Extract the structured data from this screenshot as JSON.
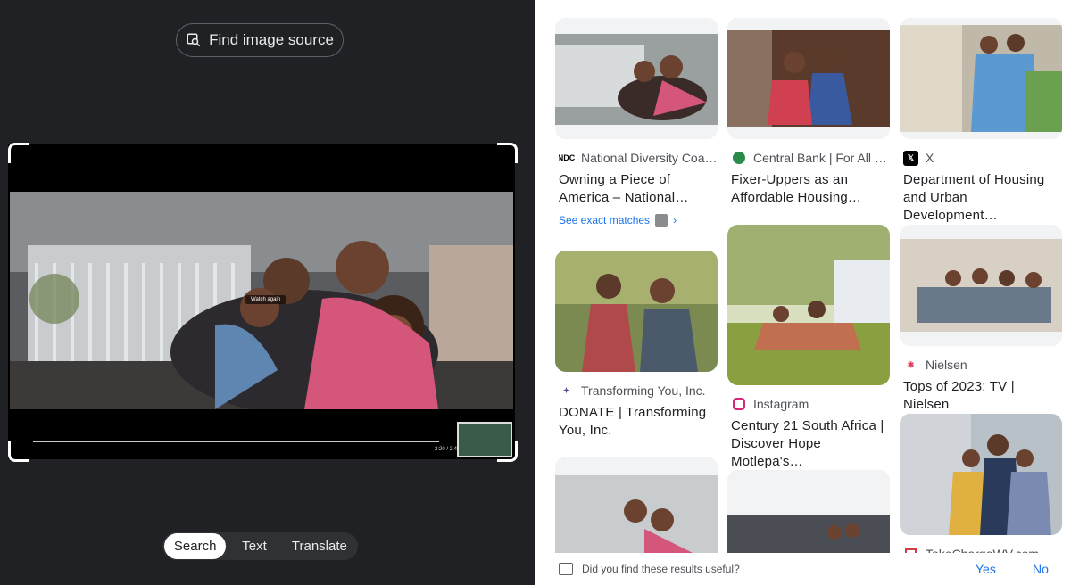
{
  "lens": {
    "find_source_label": "Find image source",
    "overlay": {
      "watch_again": "Watch again",
      "time": "2:20 / 2:4"
    },
    "modes": [
      {
        "label": "Search",
        "active": true
      },
      {
        "label": "Text",
        "active": false
      },
      {
        "label": "Translate",
        "active": false
      }
    ]
  },
  "results": [
    {
      "source": "National Diversity Coa…",
      "favicon_text": "NDC",
      "title_lines": [
        "Owning a Piece of",
        "America – National…"
      ],
      "exact_label": "See exact matches"
    },
    {
      "source": "Transforming You, Inc.",
      "title_lines": [
        "DONATE | Transforming",
        "You, Inc."
      ]
    },
    {
      "source": "Central Bank | For All …",
      "title_lines": [
        "Fixer-Uppers as an",
        "Affordable Housing…"
      ]
    },
    {
      "source": "Instagram",
      "title_lines": [
        "Century 21 South Africa |",
        "Discover Hope Motlepa's…"
      ]
    },
    {
      "source": "X",
      "favicon_text": "𝕏",
      "title_lines": [
        "Department of Housing",
        "and Urban Development…"
      ]
    },
    {
      "source": "Nielsen",
      "title_lines": [
        "Tops of 2023: TV | Nielsen"
      ]
    },
    {
      "source": "TakeChargeWV.com"
    }
  ],
  "feedback": {
    "question": "Did you find these results useful?",
    "yes": "Yes",
    "no": "No"
  },
  "colors": {
    "accent": "#1a73e8",
    "dark_bg": "#202124"
  }
}
